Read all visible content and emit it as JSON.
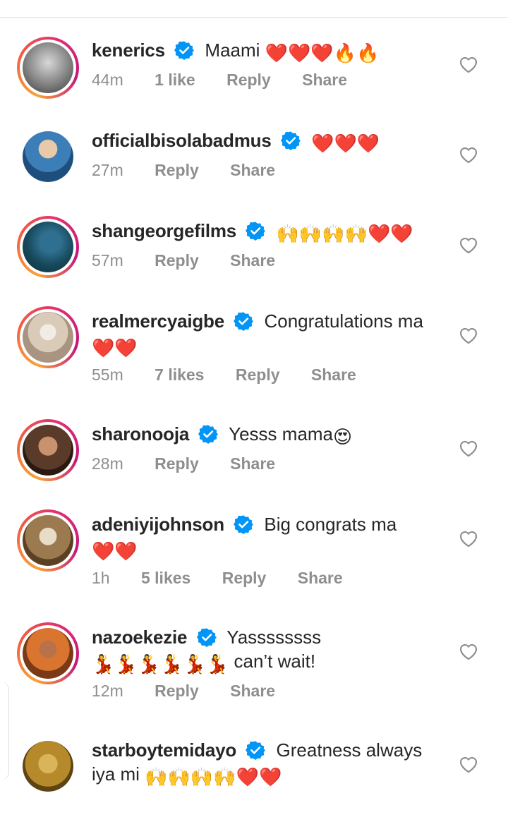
{
  "comments": [
    {
      "user": "kenerics",
      "text": "Maami",
      "emoji": "❤️❤️❤️🔥🔥",
      "time": "44m",
      "likes": "1 like",
      "reply": "Reply",
      "share": "Share",
      "avatar_color": "#7a7a7a",
      "ring": true
    },
    {
      "user": "officialbisolabadmus",
      "text": "",
      "emoji": "❤️❤️❤️",
      "time": "27m",
      "likes": "",
      "reply": "Reply",
      "share": "Share",
      "avatar_color": "#2b6fa8",
      "ring": false
    },
    {
      "user": "shangeorgefilms",
      "text": "",
      "emoji": "🙌🙌🙌🙌❤️❤️",
      "time": "57m",
      "likes": "",
      "reply": "Reply",
      "share": "Share",
      "avatar_color": "#1f5a6e",
      "ring": true
    },
    {
      "user": "realmercyaigbe",
      "text": "Congratulations ma",
      "emoji": "❤️❤️",
      "time": "55m",
      "likes": "7 likes",
      "reply": "Reply",
      "share": "Share",
      "avatar_color": "#c9b8a3",
      "ring": true
    },
    {
      "user": "sharonooja",
      "text": "Yesss mama",
      "emoji": "😍",
      "time": "28m",
      "likes": "",
      "reply": "Reply",
      "share": "Share",
      "avatar_color": "#6d4a35",
      "ring": true
    },
    {
      "user": "adeniyijohnson",
      "text": "Big congrats ma",
      "emoji": "❤️❤️",
      "time": "1h",
      "likes": "5 likes",
      "reply": "Reply",
      "share": "Share",
      "avatar_color": "#8a6a3e",
      "ring": true
    },
    {
      "user": "nazoekezie",
      "text": "Yassssssss",
      "emoji": "💃💃💃💃💃💃",
      "tail": "can’t wait!",
      "time": "12m",
      "likes": "",
      "reply": "Reply",
      "share": "Share",
      "avatar_color": "#c7622a",
      "ring": true
    },
    {
      "user": "starboytemidayo",
      "text": "Greatness always iya mi",
      "emoji": "🙌🙌🙌🙌❤️❤️",
      "time": "",
      "likes": "",
      "reply": "",
      "share": "",
      "avatar_color": "#c29a2e",
      "ring": false
    }
  ],
  "icons": {
    "verified": "verified-badge-icon",
    "like": "heart-outline-icon"
  },
  "colors": {
    "verified": "#0095f6",
    "meta": "#8e8e8e",
    "text": "#262626"
  }
}
